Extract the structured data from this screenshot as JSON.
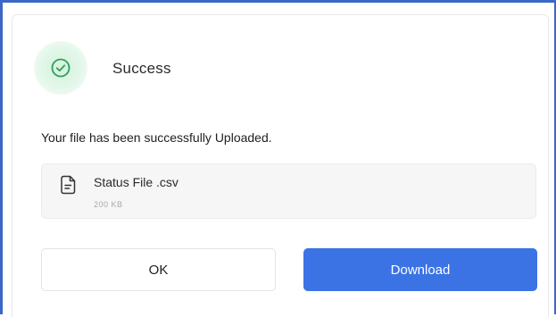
{
  "dialog": {
    "status_icon": "check-circle-icon",
    "title": "Success",
    "message": "Your file has been successfully Uploaded."
  },
  "file": {
    "icon": "file-document-icon",
    "name": "Status File .csv",
    "size": "200 KB"
  },
  "buttons": {
    "ok_label": "OK",
    "download_label": "Download"
  },
  "colors": {
    "accent": "#3b73e5",
    "success": "#2f9e5a",
    "frame": "#3b67c8"
  }
}
